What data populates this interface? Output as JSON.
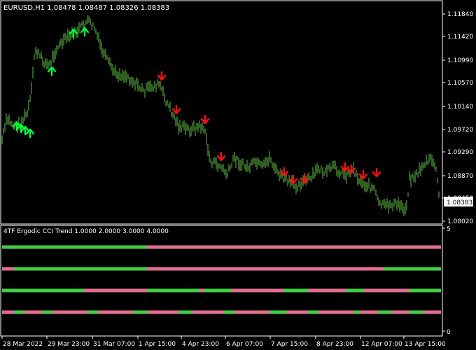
{
  "main": {
    "title": "EURUSD,H1  1.08478 1.08487 1.08326 1.08383",
    "price_ticks": [
      "1.11840",
      "1.11420",
      "1.10990",
      "1.10570",
      "1.10140",
      "1.09720",
      "1.09290",
      "1.08870",
      "1.08450",
      "1.08020"
    ],
    "current_price": "1.08383",
    "bar_color": "#5fbf3f",
    "up_arrow_color": "#00ff3c",
    "down_arrow_color": "#ff1010"
  },
  "indicator": {
    "title": "4TF Ergodic CCI Trend 1.0000 2.0000 3.0000 4.0000",
    "scale_top": "5",
    "scale_bottom": "0",
    "bull_color": "#44cc44",
    "bear_color": "#e07090"
  },
  "time_axis": [
    "28 Mar 2022",
    "29 Mar 23:00",
    "31 Mar 07:00",
    "1 Apr 15:00",
    "4 Apr 23:00",
    "6 Apr 07:00",
    "7 Apr 15:00",
    "8 Apr 23:00",
    "12 Apr 07:00",
    "13 Apr 15:00"
  ]
}
